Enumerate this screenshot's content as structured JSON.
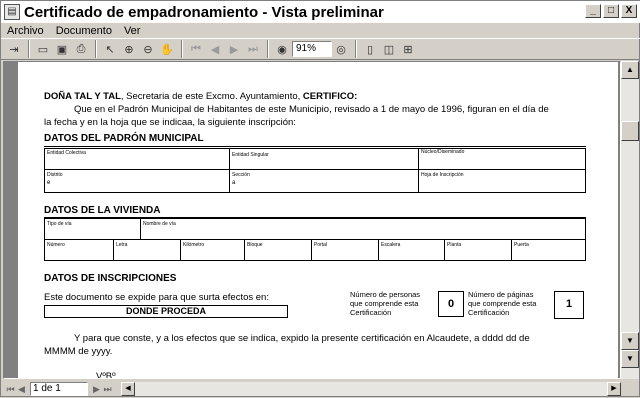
{
  "window": {
    "title": "Certificado de empadronamiento - Vista preliminar"
  },
  "title_buttons": {
    "minimize": "_",
    "maximize": "□",
    "close": "X"
  },
  "menu": [
    "Archivo",
    "Documento",
    "Ver"
  ],
  "toolbar": {
    "zoom_value": "91%"
  },
  "status": {
    "page_value": "1 de 1"
  },
  "document": {
    "intro_lead": "DOÑA TAL Y TAL",
    "intro_mid": ", Secretaria de este Excmo. Ayuntamiento, ",
    "intro_cert": "CERTIFICO:",
    "intro_body_1": "Que en el Padrón Municipal de Habitantes de este Municipio, revisado a 1 de mayo de 1996, figuran en el día de",
    "intro_body_2": "la fecha y en la hoja que se indicaa, la siguiente inscripción:",
    "section_padron": "DATOS DEL PADRÓN MUNICIPAL",
    "padron_fields": {
      "entidad_colectiva": "Entidad Colectiva",
      "entidad_singular": "Entidad Singular",
      "nucleo": "Núcleo/Diseminado",
      "distrito": "Distrito",
      "distrito_val": "e",
      "seccion": "Sección",
      "seccion_val": "a",
      "hoja": "Hoja de Inscripción"
    },
    "section_vivienda": "DATOS DE LA VIVIENDA",
    "vivienda_fields": {
      "tipo_via": "Tipo de vía",
      "nombre_via": "Nombre de vía",
      "numero": "Número",
      "letra": "Letra",
      "kilometro": "Kilómetro",
      "bloque": "Bloque",
      "portal": "Portal",
      "escalera": "Escalera",
      "planta": "Planta",
      "puerta": "Puerta"
    },
    "section_inscripciones": "DATOS DE INSCRIPCIONES",
    "expide_text": "Este documento se expide para que surta efectos en:",
    "donde_procede": "DONDE PROCEDA",
    "personas_label_1": "Número de personas",
    "personas_label_2": "que comprende esta",
    "personas_label_3": "Certificación",
    "personas_value": "0",
    "paginas_label_1": "Número de páginas",
    "paginas_label_2": "que comprende esta",
    "paginas_label_3": "Certificación",
    "paginas_value": "1",
    "closing_1": "Y para que conste, y a los efectos que se indica, expido la presente certificación en Alcaudete, a dddd dd     de",
    "closing_2": "MMMM de yyyy.",
    "vobo": "VºBº"
  }
}
